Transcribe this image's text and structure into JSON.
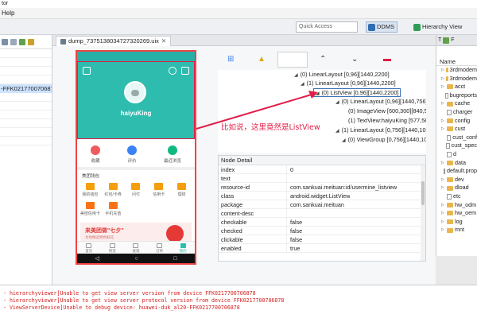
{
  "window": {
    "title": "tor"
  },
  "menu": [
    "Help",
    "Help"
  ],
  "toolbar": {
    "quick_access_placeholder": "Quick Access",
    "perspectives": [
      {
        "label": "DDMS",
        "color": "#2f6db3"
      },
      {
        "label": "Hierarchy View",
        "color": "#2e9e57"
      }
    ]
  },
  "left_pane": {
    "device": "-FFK0217700706878"
  },
  "editor": {
    "tab_title": "dump_7375138034727320269.uix"
  },
  "phone": {
    "status_left": "",
    "status_right": "",
    "username": "haiyuKing",
    "quick_items": [
      {
        "label": "收藏",
        "color": "#ef5a5a"
      },
      {
        "label": "评价",
        "color": "#3b82f6"
      },
      {
        "label": "最近浏览",
        "color": "#10b981"
      }
    ],
    "section_label": "美团钱包",
    "grid_items": [
      "我的钱包",
      "红包/卡券",
      "问付",
      "信用卡",
      "理财",
      "美团信用卡",
      "手机充值",
      "",
      "",
      ""
    ],
    "banner_title": "来美团做\"七夕\"",
    "banner_sub": "为你精选特色鲜花",
    "tabbar": [
      {
        "label": "首页",
        "active": false
      },
      {
        "label": "附近",
        "active": false
      },
      {
        "label": "发现",
        "active": false
      },
      {
        "label": "订单",
        "active": false
      },
      {
        "label": "我的",
        "active": true
      }
    ],
    "nav": [
      "◁",
      "○",
      "□"
    ]
  },
  "tree": {
    "nodes": [
      {
        "label": "(0) LinearLayout [0,96][1440,2200]",
        "expanded": true,
        "selected": false
      },
      {
        "label": "(1) LinearLayout [0,96][1440,2200]",
        "expanded": true,
        "selected": false
      },
      {
        "label": "(0) ListView [0,96][1440,2200]",
        "expanded": true,
        "selected": true
      },
      {
        "label": "(0) LinearLayout [0,96][1440,756]",
        "expanded": true,
        "selected": false
      },
      {
        "label": "(0) ImageView [600,300][840,5",
        "expanded": false,
        "selected": false
      },
      {
        "label": "(1) TextView:haiyuKing [577,56",
        "expanded": false,
        "selected": false
      },
      {
        "label": "(1) LinearLayout [0,756][1440,1068",
        "expanded": true,
        "selected": false
      },
      {
        "label": "(0) ViewGroup [0,756][1440,10",
        "expanded": true,
        "selected": false
      }
    ]
  },
  "annotation": "比如说，这里竟然是ListView",
  "node_detail": {
    "title": "Node Detail",
    "rows": [
      {
        "key": "index",
        "value": "0"
      },
      {
        "key": "text",
        "value": ""
      },
      {
        "key": "resource-id",
        "value": "com.sankuai.meituan:id/usermine_listview"
      },
      {
        "key": "class",
        "value": "android.widget.ListView"
      },
      {
        "key": "package",
        "value": "com.sankuai.meituan"
      },
      {
        "key": "content-desc",
        "value": ""
      },
      {
        "key": "checkable",
        "value": "false"
      },
      {
        "key": "checked",
        "value": "false"
      },
      {
        "key": "clickable",
        "value": "false"
      },
      {
        "key": "enabled",
        "value": "true"
      }
    ]
  },
  "right_pane": {
    "tabs": [
      "T",
      "F"
    ],
    "header": "Name",
    "items": [
      {
        "name": "3rdmodem",
        "type": "folder"
      },
      {
        "name": "3rdmodem",
        "type": "folder"
      },
      {
        "name": "acct",
        "type": "folder"
      },
      {
        "name": "bugreports",
        "type": "file"
      },
      {
        "name": "cache",
        "type": "folder"
      },
      {
        "name": "charger",
        "type": "file"
      },
      {
        "name": "config",
        "type": "folder"
      },
      {
        "name": "cust",
        "type": "folder"
      },
      {
        "name": "cust_conf",
        "type": "file"
      },
      {
        "name": "cust_spec",
        "type": "file"
      },
      {
        "name": "d",
        "type": "file"
      },
      {
        "name": "data",
        "type": "folder"
      },
      {
        "name": "default.prop",
        "type": "file"
      },
      {
        "name": "dev",
        "type": "folder"
      },
      {
        "name": "dload",
        "type": "folder"
      },
      {
        "name": "etc",
        "type": "file"
      },
      {
        "name": "hw_odm",
        "type": "folder"
      },
      {
        "name": "hw_oem",
        "type": "folder"
      },
      {
        "name": "log",
        "type": "folder"
      },
      {
        "name": "mnt",
        "type": "folder"
      }
    ]
  },
  "console": {
    "lines": [
      "- hierarchyviewer]Unable to get view server version from device FFK0217700706878",
      "- hierarchyviewer]Unable to get view server protocol version from device FFK0217700706878",
      "- ViewServerDevice]Unable to debug device: huawei-duk_al20-FFK0217700706878"
    ]
  },
  "colors": {
    "accent": "#2ebcae",
    "highlight": "#e11d48",
    "selection": "#3b6fb6"
  }
}
